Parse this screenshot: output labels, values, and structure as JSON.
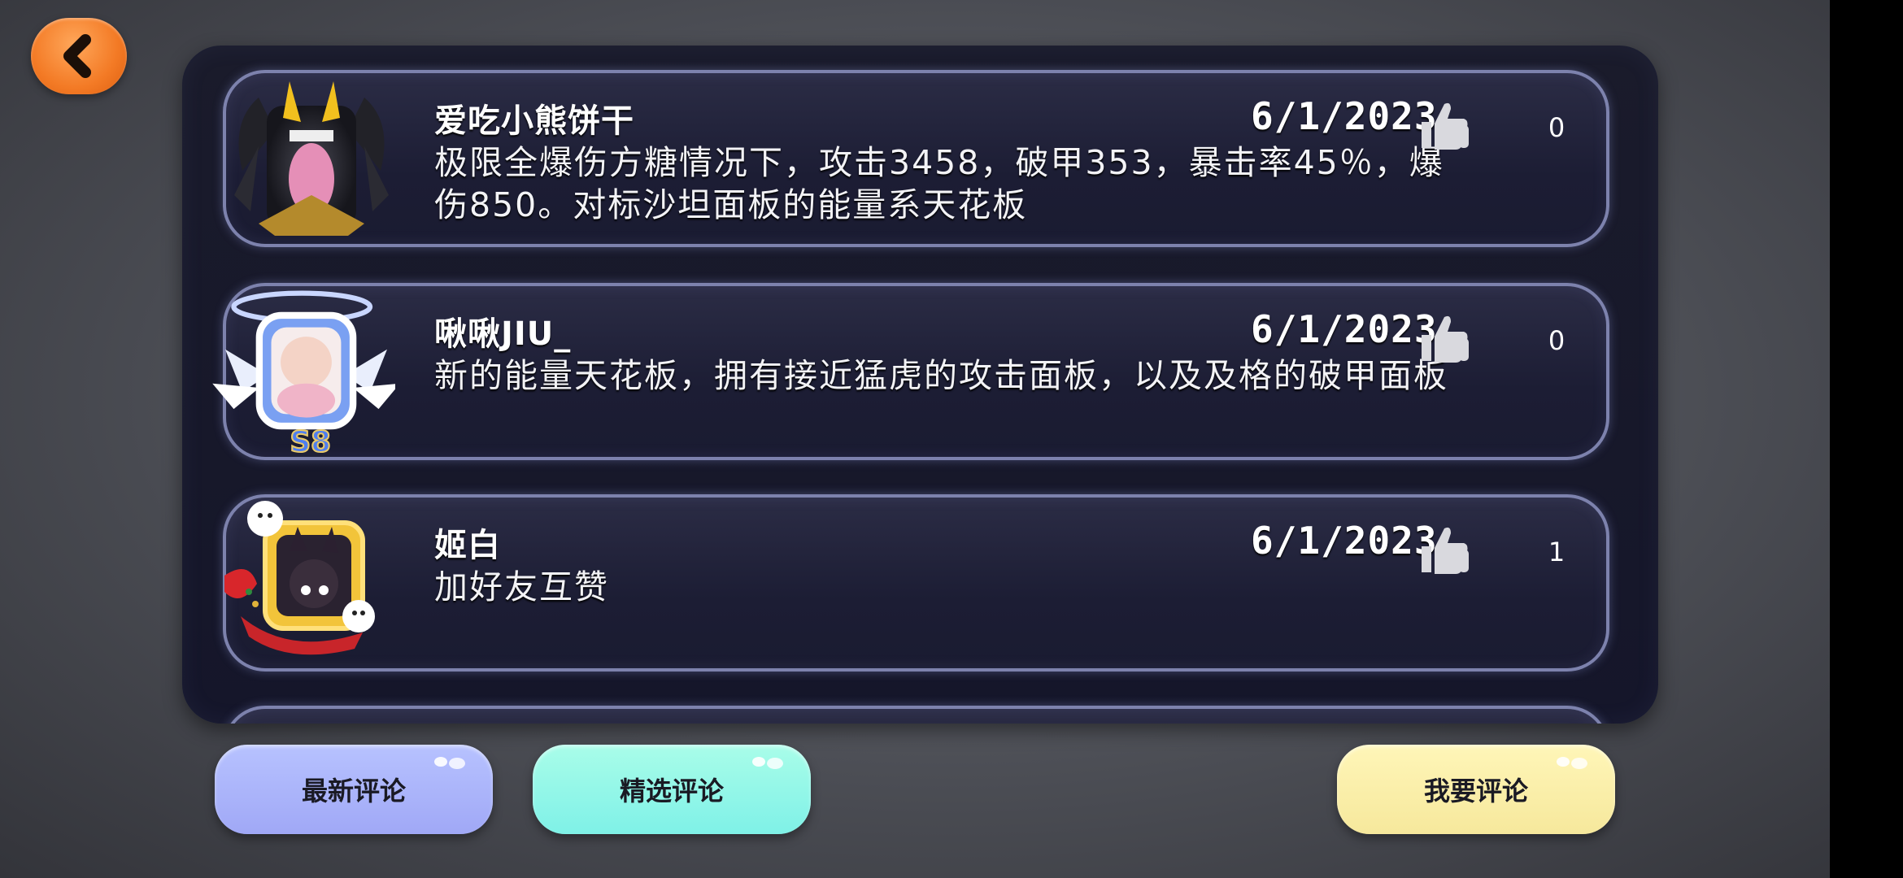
{
  "header": {
    "back_icon": "chevron-left-icon"
  },
  "comments": [
    {
      "username": "爱吃小熊饼干",
      "date": "6/1/2023",
      "text": "极限全爆伤方糖情况下，攻击3458，破甲353，暴击率45％，爆伤850。对标沙坦面板的能量系天花板",
      "likes": "0",
      "avatar": "avatar-dark-fox-frame"
    },
    {
      "username": "啾啾JIU_",
      "date": "6/1/2023",
      "text": "新的能量天花板，拥有接近猛虎的攻击面板，以及及格的破甲面板",
      "likes": "0",
      "avatar": "avatar-s8-winged-frame",
      "badge": "S8"
    },
    {
      "username": "姬白",
      "date": "6/1/2023",
      "text": "加好友互赞",
      "likes": "1",
      "avatar": "avatar-gold-frame-catgirl"
    }
  ],
  "buttons": {
    "latest": "最新评论",
    "selected": "精选评论",
    "write": "我要评论"
  },
  "colors": {
    "back_button": "#f37a25",
    "panel_bg": "#1a1b2b",
    "card_border": "#7d82ad",
    "latest_button": "#a0a8f6",
    "selected_button": "#7ff1e7",
    "write_button": "#f6e89c"
  }
}
